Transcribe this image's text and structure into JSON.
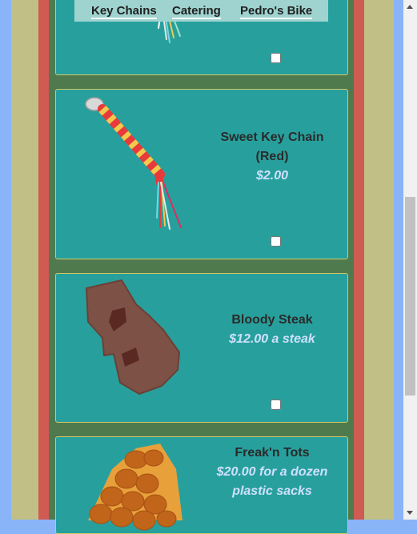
{
  "nav": {
    "items": [
      "Key Chains",
      "Catering",
      "Pedro's Bike"
    ]
  },
  "products": [
    {
      "name": "Sweet Key Chain (Red)",
      "price": "$2.00",
      "image": "keychain-icon",
      "checked": false
    },
    {
      "name": "Bloody Steak",
      "price": "$12.00 a steak",
      "image": "steak-icon",
      "checked": false
    },
    {
      "name": "Freak'n Tots",
      "price": "$20.00 for a dozen plastic sacks",
      "image": "tots-icon",
      "checked": false
    }
  ],
  "colors": {
    "card_bg": "#27a09d",
    "card_border": "#d2c866",
    "page_green": "#4f7a4e",
    "stripe_red": "#cf5b52",
    "stripe_tan": "#c2bf86",
    "price_text": "#cfe0ff"
  }
}
